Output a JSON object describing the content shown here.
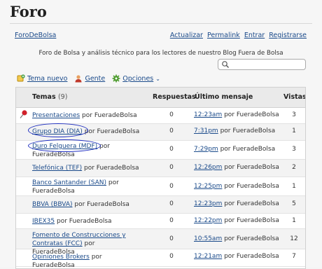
{
  "forum": {
    "title": "Foro",
    "home_link": "ForoDeBolsa",
    "links": [
      "Actualizar",
      "Permalink",
      "Entrar",
      "Registrarse"
    ],
    "description": "Foro de Bolsa y análisis técnico para los lectores de nuestro Blog Fuera de Bolsa",
    "search": {
      "placeholder": ""
    }
  },
  "toolbar": {
    "new_topic": "Tema nuevo",
    "people": "Gente",
    "options": "Opciones"
  },
  "table": {
    "headers": {
      "topics": "Temas",
      "topics_count": "(9)",
      "replies": "Respuestas",
      "last": "Último mensaje",
      "views": "Vistas"
    },
    "rows": [
      {
        "topic": "Presentaciones",
        "by": "por FueradeBolsa",
        "replies": "0",
        "time": "12:23am",
        "last_by": "por FueradeBolsa",
        "views": "3"
      },
      {
        "topic": "Grupo DIA (DIA)",
        "by": "por FueradeBolsa",
        "replies": "0",
        "time": "7:31pm",
        "last_by": "por FueradeBolsa",
        "views": "1"
      },
      {
        "topic": "Duro Felguera (MDF)",
        "by": "por FueradeBolsa",
        "replies": "0",
        "time": "7:29pm",
        "last_by": "por FueradeBolsa",
        "views": "3"
      },
      {
        "topic": "Telefónica (TEF)",
        "by": "por FueradeBolsa",
        "replies": "0",
        "time": "12:26pm",
        "last_by": "por FueradeBolsa",
        "views": "2"
      },
      {
        "topic": "Banco Santander (SAN)",
        "by": "por FueradeBolsa",
        "replies": "0",
        "time": "12:25pm",
        "last_by": "por FueradeBolsa",
        "views": "1"
      },
      {
        "topic": "BBVA (BBVA)",
        "by": "por FueradeBolsa",
        "replies": "0",
        "time": "12:23pm",
        "last_by": "por FueradeBolsa",
        "views": "5"
      },
      {
        "topic": "IBEX35",
        "by": "por FueradeBolsa",
        "replies": "0",
        "time": "12:22pm",
        "last_by": "por FueradeBolsa",
        "views": "1"
      },
      {
        "topic": "Fomento de Construcciones y Contratas (FCC)",
        "by": "por FueradeBolsa",
        "replies": "0",
        "time": "10:55am",
        "last_by": "por FueradeBolsa",
        "views": "12"
      },
      {
        "topic": "Opiniones Brokers",
        "by": "por FueradeBolsa",
        "replies": "0",
        "time": "12:21am",
        "last_by": "por FueradeBolsa",
        "views": "7"
      }
    ]
  },
  "colors": {
    "link": "#1a4a8a",
    "annotation": "#1f2fc0",
    "header_bg": "#eaeaea"
  }
}
